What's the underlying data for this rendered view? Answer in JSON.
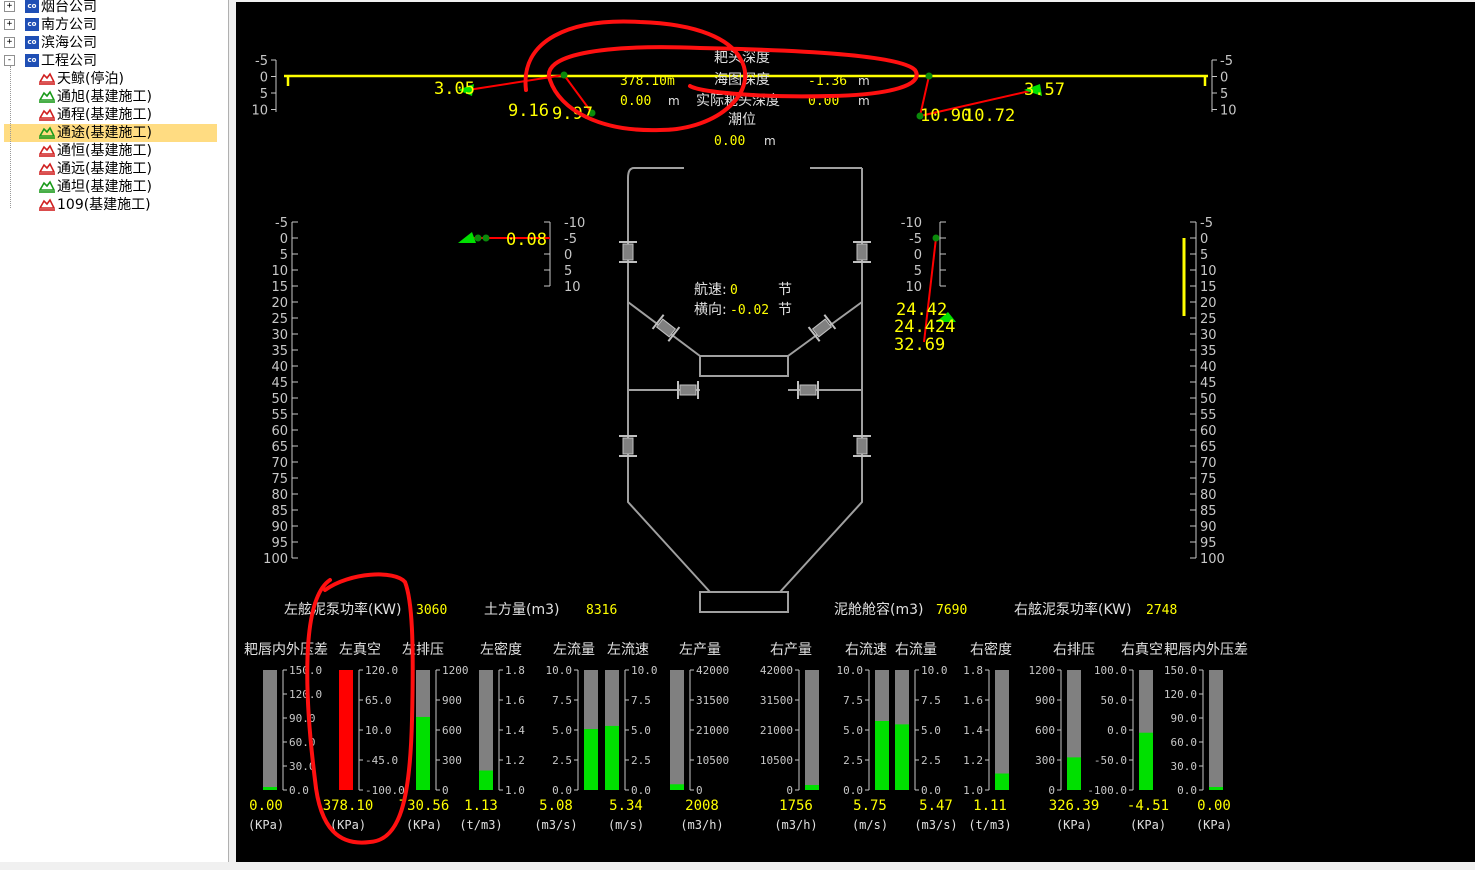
{
  "tree": {
    "companies": [
      {
        "label": "烟台公司",
        "expander": "+"
      },
      {
        "label": "南方公司",
        "expander": "+"
      },
      {
        "label": "滨海公司",
        "expander": "+"
      },
      {
        "label": "工程公司",
        "expander": "-"
      }
    ],
    "company_icon_text": "co",
    "ships": [
      {
        "label": "天鲸(停泊)",
        "status": "red"
      },
      {
        "label": "通旭(基建施工)",
        "status": "green"
      },
      {
        "label": "通程(基建施工)",
        "status": "red"
      },
      {
        "label": "通途(基建施工)",
        "status": "green",
        "selected": true
      },
      {
        "label": "通恒(基建施工)",
        "status": "red"
      },
      {
        "label": "通远(基建施工)",
        "status": "red"
      },
      {
        "label": "通坦(基建施工)",
        "status": "green"
      },
      {
        "label": "109(基建施工)",
        "status": "red"
      }
    ]
  },
  "colors": {
    "yellow": "#ffff00",
    "green": "#00e000",
    "red": "#ff0000",
    "gray": "#808080",
    "bg": "#000000"
  },
  "top": {
    "left_scale": [
      "-5",
      "0",
      "5",
      "10"
    ],
    "right_scale": [
      "-5",
      "0",
      "5",
      "10"
    ],
    "left_depth_values": [
      "3.05",
      "9.16",
      "9.97"
    ],
    "right_depth_values": [
      "3.57",
      "10.90",
      "10.72"
    ],
    "harrow_length_label": "耙头深度",
    "harrow_length_value": "378.10m",
    "chart_depth_label": "海图深度",
    "chart_depth_value": "-1.36",
    "chart_depth_unit": "m",
    "second_value": "0.00",
    "second_unit": "m",
    "actual_label": "实际耙头深度",
    "actual_value": "0.00",
    "actual_unit": "m",
    "tide_label": "潮位",
    "tide_value": "0.00",
    "tide_unit": "m"
  },
  "side": {
    "depth_scale": [
      "-5",
      "0",
      "5",
      "10",
      "15",
      "20",
      "25",
      "30",
      "35",
      "40",
      "45",
      "50",
      "55",
      "60",
      "65",
      "70",
      "75",
      "80",
      "85",
      "90",
      "95",
      "100"
    ],
    "small_scale": [
      "-10",
      "-5",
      "0",
      "5",
      "10"
    ],
    "left_value": "0.08",
    "right_values": [
      "24.42",
      "24.424",
      "32.69"
    ]
  },
  "nav": {
    "speed_label": "航速:",
    "speed_value": "0",
    "speed_unit": "节",
    "lateral_label": "横向:",
    "lateral_value": "-0.02",
    "lateral_unit": "节"
  },
  "info": {
    "left_pump_label": "左舷泥泵功率(KW)",
    "left_pump_value": "3060",
    "earthwork_label": "土方量(m3)",
    "earthwork_value": "8316",
    "hopper_label": "泥舱舱容(m3)",
    "hopper_value": "7690",
    "right_pump_label": "右舷泥泵功率(KW)",
    "right_pump_value": "2748"
  },
  "gauges": [
    {
      "name": "left-harrow-pressure",
      "label": "耙唇内外压差",
      "ticks": [
        "150.0",
        "120.0",
        "90.0",
        "60.0",
        "30.0",
        "0.0"
      ],
      "min": 0,
      "max": 150,
      "value_num": 0,
      "value": "0.00",
      "unit": "(KPa)",
      "color": "green",
      "tick_side": "right"
    },
    {
      "name": "left-vacuum",
      "label": "左真空",
      "ticks": [
        "120.0",
        "65.0",
        "10.0",
        "-45.0",
        "-100.0"
      ],
      "min": -100,
      "max": 120,
      "value_num": 120,
      "value": "378.10",
      "unit": "(KPa)",
      "color": "red",
      "tick_side": "right"
    },
    {
      "name": "left-discharge",
      "label": "左排压",
      "ticks": [
        "1200",
        "900",
        "600",
        "300",
        "0"
      ],
      "min": 0,
      "max": 1200,
      "value_num": 730.56,
      "value": "730.56",
      "unit": "(KPa)",
      "color": "green",
      "tick_side": "right"
    },
    {
      "name": "left-density",
      "label": "左密度",
      "ticks": [
        "1.8",
        "1.6",
        "1.4",
        "1.2",
        "1.0"
      ],
      "min": 1.0,
      "max": 1.8,
      "value_num": 1.13,
      "value": "1.13",
      "unit": "(t/m3)",
      "color": "green",
      "tick_side": "right"
    },
    {
      "name": "left-flow",
      "label": "左流量",
      "ticks": [
        "10.0",
        "7.5",
        "5.0",
        "2.5",
        "0.0"
      ],
      "min": 0,
      "max": 10,
      "value_num": 5.08,
      "value": "5.08",
      "unit": "(m3/s)",
      "color": "green",
      "tick_side": "left"
    },
    {
      "name": "left-velocity",
      "label": "左流速",
      "ticks": [
        "10.0",
        "7.5",
        "5.0",
        "2.5",
        "0.0"
      ],
      "min": 0,
      "max": 10,
      "value_num": 5.34,
      "value": "5.34",
      "unit": "(m/s)",
      "color": "green",
      "tick_side": "right"
    },
    {
      "name": "left-output",
      "label": "左产量",
      "ticks": [
        "42000",
        "31500",
        "21000",
        "10500",
        "0"
      ],
      "min": 0,
      "max": 42000,
      "value_num": 2008,
      "value": "2008",
      "unit": "(m3/h)",
      "color": "green",
      "tick_side": "right"
    },
    {
      "name": "right-output",
      "label": "右产量",
      "ticks": [
        "42000",
        "31500",
        "21000",
        "10500",
        "0"
      ],
      "min": 0,
      "max": 42000,
      "value_num": 1756,
      "value": "1756",
      "unit": "(m3/h)",
      "color": "green",
      "tick_side": "left"
    },
    {
      "name": "right-velocity",
      "label": "右流速",
      "ticks": [
        "10.0",
        "7.5",
        "5.0",
        "2.5",
        "0.0"
      ],
      "min": 0,
      "max": 10,
      "value_num": 5.75,
      "value": "5.75",
      "unit": "(m/s)",
      "color": "green",
      "tick_side": "left"
    },
    {
      "name": "right-flow",
      "label": "右流量",
      "ticks": [
        "10.0",
        "7.5",
        "5.0",
        "2.5",
        "0.0"
      ],
      "min": 0,
      "max": 10,
      "value_num": 5.47,
      "value": "5.47",
      "unit": "(m3/s)",
      "color": "green",
      "tick_side": "right"
    },
    {
      "name": "right-density",
      "label": "右密度",
      "ticks": [
        "1.8",
        "1.6",
        "1.4",
        "1.2",
        "1.0"
      ],
      "min": 1.0,
      "max": 1.8,
      "value_num": 1.11,
      "value": "1.11",
      "unit": "(t/m3)",
      "color": "green",
      "tick_side": "left"
    },
    {
      "name": "right-discharge",
      "label": "右排压",
      "ticks": [
        "1200",
        "900",
        "600",
        "300",
        "0"
      ],
      "min": 0,
      "max": 1200,
      "value_num": 326.39,
      "value": "326.39",
      "unit": "(KPa)",
      "color": "green",
      "tick_side": "left"
    },
    {
      "name": "right-vacuum",
      "label": "右真空",
      "ticks": [
        "100.0",
        "50.0",
        "0.0",
        "-50.0",
        "-100.0"
      ],
      "min": -100,
      "max": 100,
      "value_num": -4.51,
      "value": "-4.51",
      "unit": "(KPa)",
      "color": "green",
      "tick_side": "left"
    },
    {
      "name": "right-harrow-pressure",
      "label": "耙唇内外压差",
      "ticks": [
        "150.0",
        "120.0",
        "90.0",
        "60.0",
        "30.0",
        "0.0"
      ],
      "min": 0,
      "max": 150,
      "value_num": 0,
      "value": "0.00",
      "unit": "(KPa)",
      "color": "green",
      "tick_side": "left"
    }
  ]
}
